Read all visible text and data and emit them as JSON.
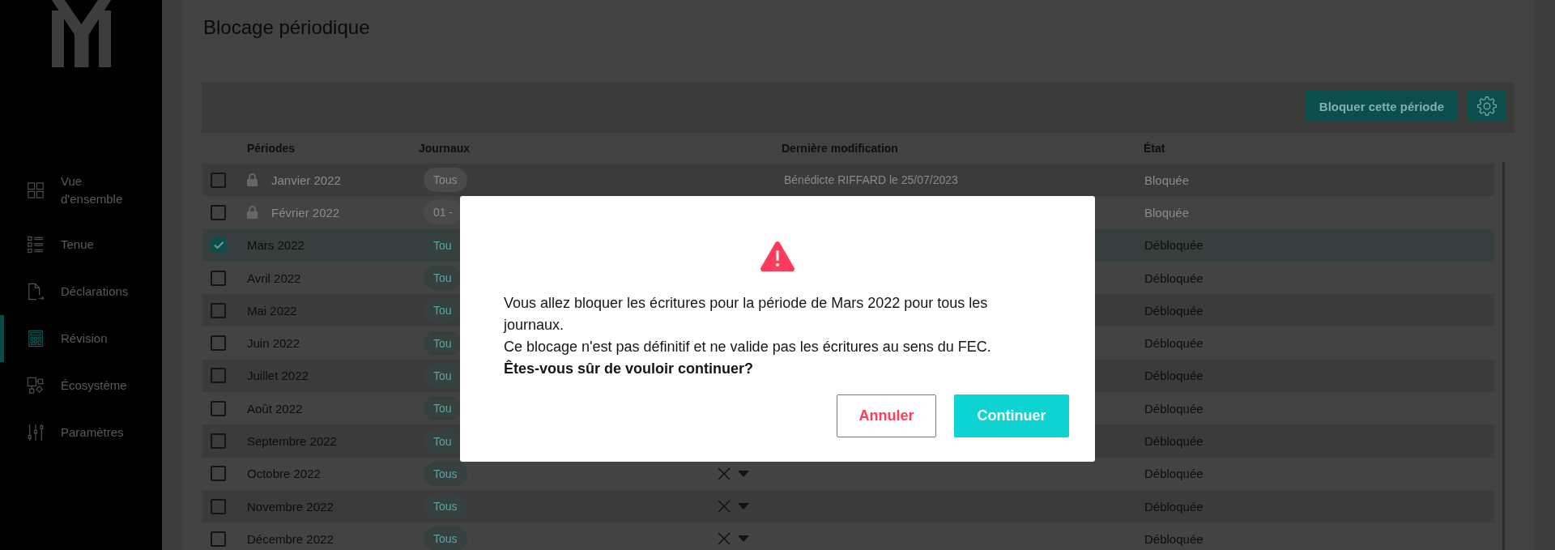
{
  "sidebar": {
    "items": [
      {
        "label": "Vue d'ensemble",
        "selected": false
      },
      {
        "label": "Tenue",
        "selected": false
      },
      {
        "label": "Déclarations",
        "selected": false
      },
      {
        "label": "Révision",
        "selected": true
      },
      {
        "label": "Écosystème",
        "selected": false
      },
      {
        "label": "Paramètres",
        "selected": false
      }
    ]
  },
  "page": {
    "title": "Blocage périodique"
  },
  "toolbar": {
    "block_button": "Bloquer cette période"
  },
  "table": {
    "columns": [
      "Périodes",
      "Journaux",
      "Dernière modification",
      "État"
    ],
    "rows": [
      {
        "period": "Janvier 2022",
        "locked": true,
        "checked": false,
        "journals": "Tous",
        "select_controls": false,
        "modified": "Bénédicte RIFFARD le 25/07/2023",
        "state": "Bloquée"
      },
      {
        "period": "Février 2022",
        "locked": true,
        "checked": false,
        "journals": "01 -",
        "select_controls": false,
        "state": "Bloquée"
      },
      {
        "period": "Mars 2022",
        "locked": false,
        "checked": true,
        "journals": "Tou",
        "select_controls": false,
        "state": "Débloquée"
      },
      {
        "period": "Avril 2022",
        "locked": false,
        "checked": false,
        "journals": "Tou",
        "select_controls": false,
        "state": "Débloquée"
      },
      {
        "period": "Mai 2022",
        "locked": false,
        "checked": false,
        "journals": "Tou",
        "select_controls": false,
        "state": "Débloquée"
      },
      {
        "period": "Juin 2022",
        "locked": false,
        "checked": false,
        "journals": "Tou",
        "select_controls": false,
        "state": "Débloquée"
      },
      {
        "period": "Juillet 2022",
        "locked": false,
        "checked": false,
        "journals": "Tou",
        "select_controls": false,
        "state": "Débloquée"
      },
      {
        "period": "Août 2022",
        "locked": false,
        "checked": false,
        "journals": "Tou",
        "select_controls": false,
        "state": "Débloquée"
      },
      {
        "period": "Septembre 2022",
        "locked": false,
        "checked": false,
        "journals": "Tou",
        "select_controls": false,
        "state": "Débloquée"
      },
      {
        "period": "Octobre 2022",
        "locked": false,
        "checked": false,
        "journals": "Tous",
        "select_controls": true,
        "state": "Débloquée"
      },
      {
        "period": "Novembre 2022",
        "locked": false,
        "checked": false,
        "journals": "Tous",
        "select_controls": true,
        "state": "Débloquée"
      },
      {
        "period": "Décembre 2022",
        "locked": false,
        "checked": false,
        "journals": "Tous",
        "select_controls": true,
        "state": "Débloquée"
      }
    ]
  },
  "dialog": {
    "message": "Vous allez bloquer les écritures pour la période de Mars 2022 pour tous les journaux.",
    "note": "Ce blocage n'est pas définitif et ne valide pas les écritures au sens du FEC.",
    "question": "Êtes-vous sûr de vouloir continuer?",
    "buttons": [
      {
        "label": "Annuler",
        "kind": "secondary"
      },
      {
        "label": "Continuer",
        "kind": "primary"
      }
    ]
  }
}
